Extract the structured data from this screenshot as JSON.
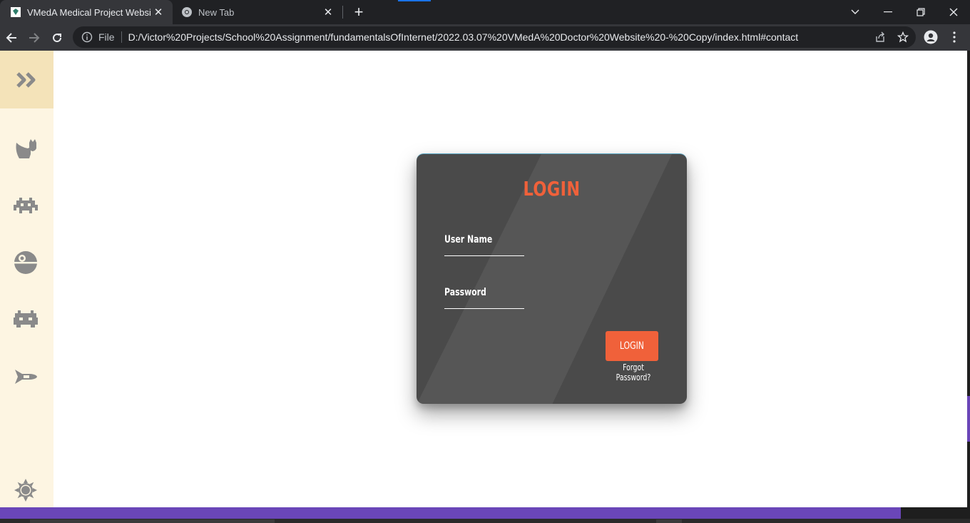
{
  "browser": {
    "tabs": [
      {
        "title": "VMedA Medical Project Website",
        "active": true
      },
      {
        "title": "New Tab",
        "active": false
      }
    ],
    "address": {
      "scheme_label": "File",
      "url": "D:/Victor%20Projects/School%20Assignment/fundamentalsOfInternet/2022.03.07%20VMedA%20Doctor%20Website%20-%20Copy/index.html#contact"
    }
  },
  "sidebar": {
    "toggle_icon": "double-chevron-right-icon",
    "items": [
      {
        "icon": "cat-icon"
      },
      {
        "icon": "space-invader-icon"
      },
      {
        "icon": "death-star-icon"
      },
      {
        "icon": "alien-icon"
      },
      {
        "icon": "spaceship-icon"
      }
    ],
    "settings_icon": "sun-gear-icon",
    "icon_color": "#8a8a8a"
  },
  "login": {
    "title": "LOGIN",
    "username_label": "User Name",
    "password_label": "Password",
    "button_label": "LOGIN",
    "forgot_label": "Forgot Password?",
    "accent_color": "#f0613a",
    "card_color": "#4a4a4a"
  },
  "footer": {
    "bar_color": "#6a46b8"
  }
}
